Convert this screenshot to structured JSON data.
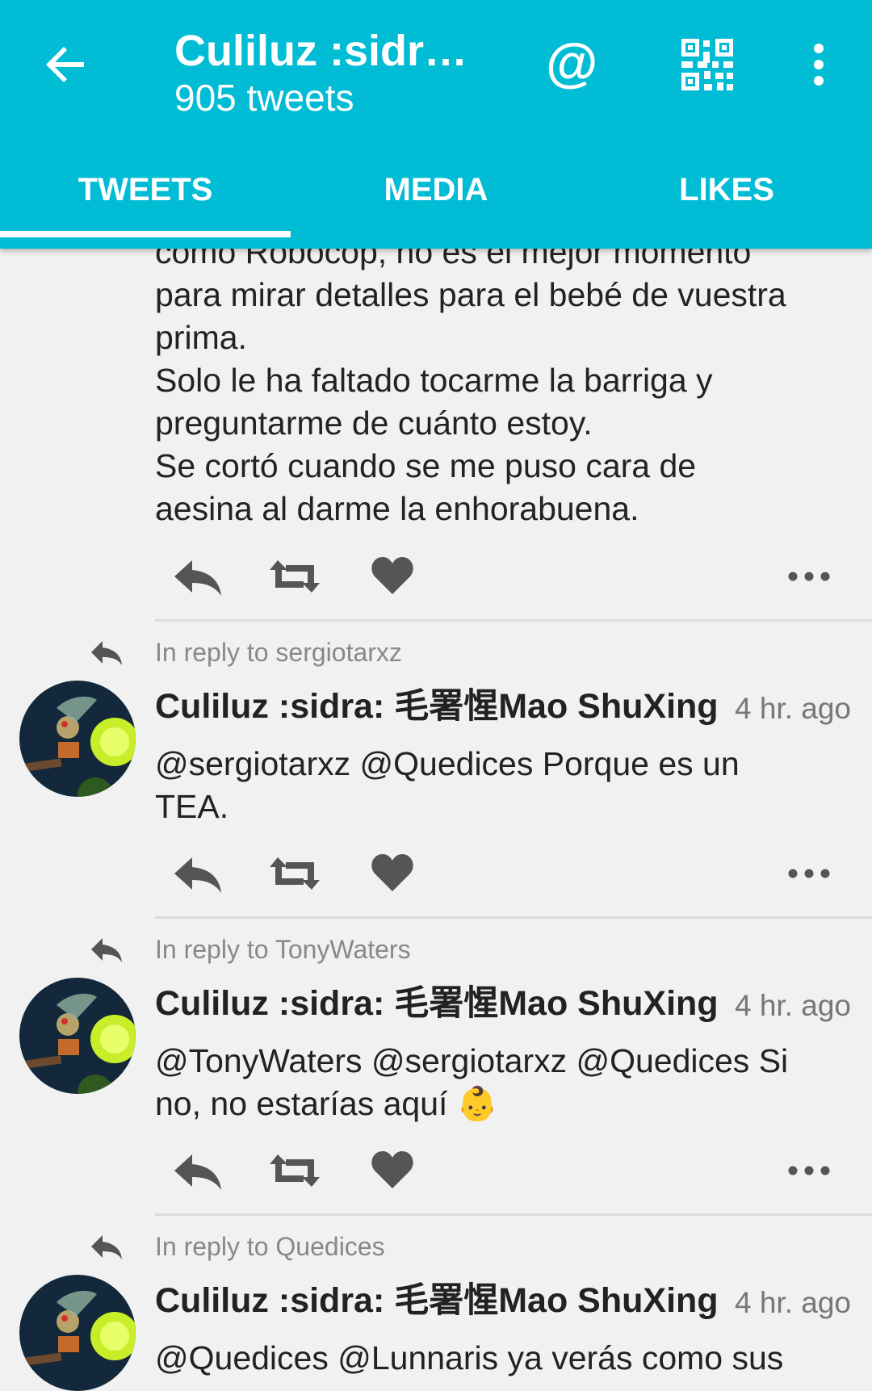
{
  "header": {
    "title": "Culiluz :sidra: 毛署惺Mao ShuXing",
    "subtitle": "905 tweets",
    "icons": [
      "back-arrow-icon",
      "mention-at-icon",
      "qr-code-icon",
      "overflow-menu-icon"
    ],
    "mention_glyph": "@"
  },
  "tabs": [
    {
      "label": "TWEETS",
      "active": true
    },
    {
      "label": "MEDIA",
      "active": false
    },
    {
      "label": "LIKES",
      "active": false
    }
  ],
  "colors": {
    "accent": "#00bcd4",
    "background": "#f1f1f1",
    "text": "#222222",
    "muted": "#888888",
    "icon_gray": "#555555"
  },
  "tweets": [
    {
      "text": "como Robocop, no es el mejor momento\npara mirar detalles para el bebé de vuestra\nprima.\nSolo le ha faltado tocarme la barriga y\npreguntarme de cuánto estoy.\nSe cortó cuando se me puso cara de\naesina al darme la enhorabuena."
    },
    {
      "reply_to": "In reply to sergiotarxz",
      "author": "Culiluz :sidra: 毛署惺Mao ShuXing",
      "time": "4 hr. ago",
      "text": "@sergiotarxz @Quedices Porque es un\nTEA."
    },
    {
      "reply_to": "In reply to TonyWaters",
      "author": "Culiluz :sidra: 毛署惺Mao ShuXing",
      "time": "4 hr. ago",
      "text": "@TonyWaters @sergiotarxz @Quedices Si\nno, no estarías aquí 👶"
    },
    {
      "reply_to": "In reply to Quedices",
      "author": "Culiluz :sidra: 毛署惺Mao ShuXing",
      "time": "4 hr. ago",
      "text": "@Quedices @Lunnaris ya verás como sus"
    }
  ],
  "action_icons": [
    "reply-icon",
    "retweet-icon",
    "like-heart-icon",
    "more-options-icon"
  ]
}
